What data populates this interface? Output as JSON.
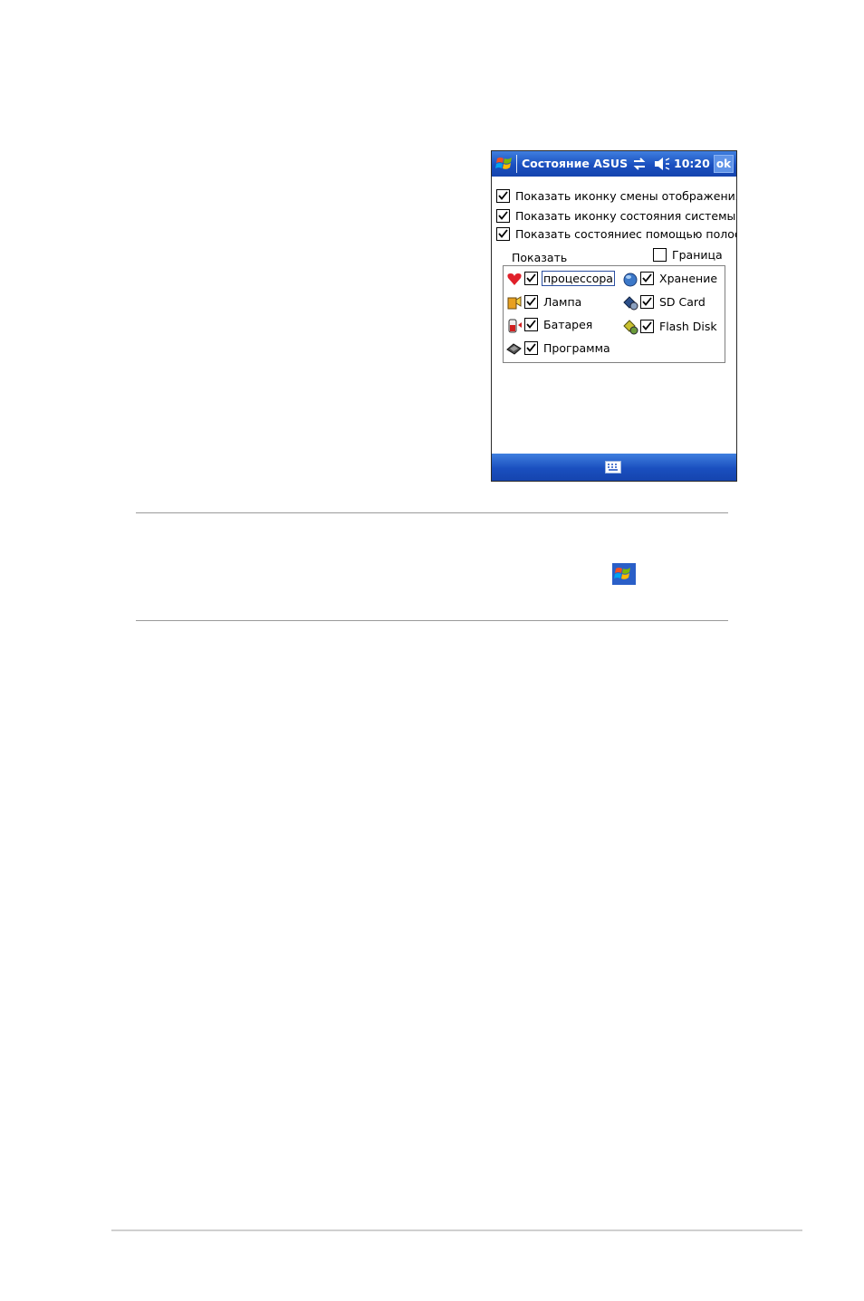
{
  "window": {
    "title": "Состояние ASUS",
    "clock": "10:20",
    "ok_label": "ok",
    "icons": [
      "windows-start-icon",
      "sync-icon",
      "speaker-icon",
      "keyboard-icon"
    ]
  },
  "options": [
    {
      "label": "Показать иконку смены отображения",
      "checked": true
    },
    {
      "label": "Показать иконку состояния системы",
      "checked": true
    },
    {
      "label": "Показать состояниес помощью полос",
      "checked": true
    }
  ],
  "show_label": "Показать",
  "border_option": {
    "label": "Граница",
    "checked": false
  },
  "items": [
    {
      "label": "процессора",
      "icon": "heart-icon",
      "checked": true
    },
    {
      "label": "Хранение",
      "icon": "storage-icon",
      "checked": true
    },
    {
      "label": "Лампа",
      "icon": "lamp-icon",
      "checked": true
    },
    {
      "label": "SD Card",
      "icon": "sd-card-icon",
      "checked": true
    },
    {
      "label": "Батарея",
      "icon": "battery-icon",
      "checked": true
    },
    {
      "label": "Flash Disk",
      "icon": "flash-disk-icon",
      "checked": true
    },
    {
      "label": "Программа",
      "icon": "program-icon",
      "checked": true
    }
  ],
  "colors": {
    "titlebar": "#1a4fbf",
    "accent": "#3f7fdf",
    "heart": "#e0202a"
  }
}
